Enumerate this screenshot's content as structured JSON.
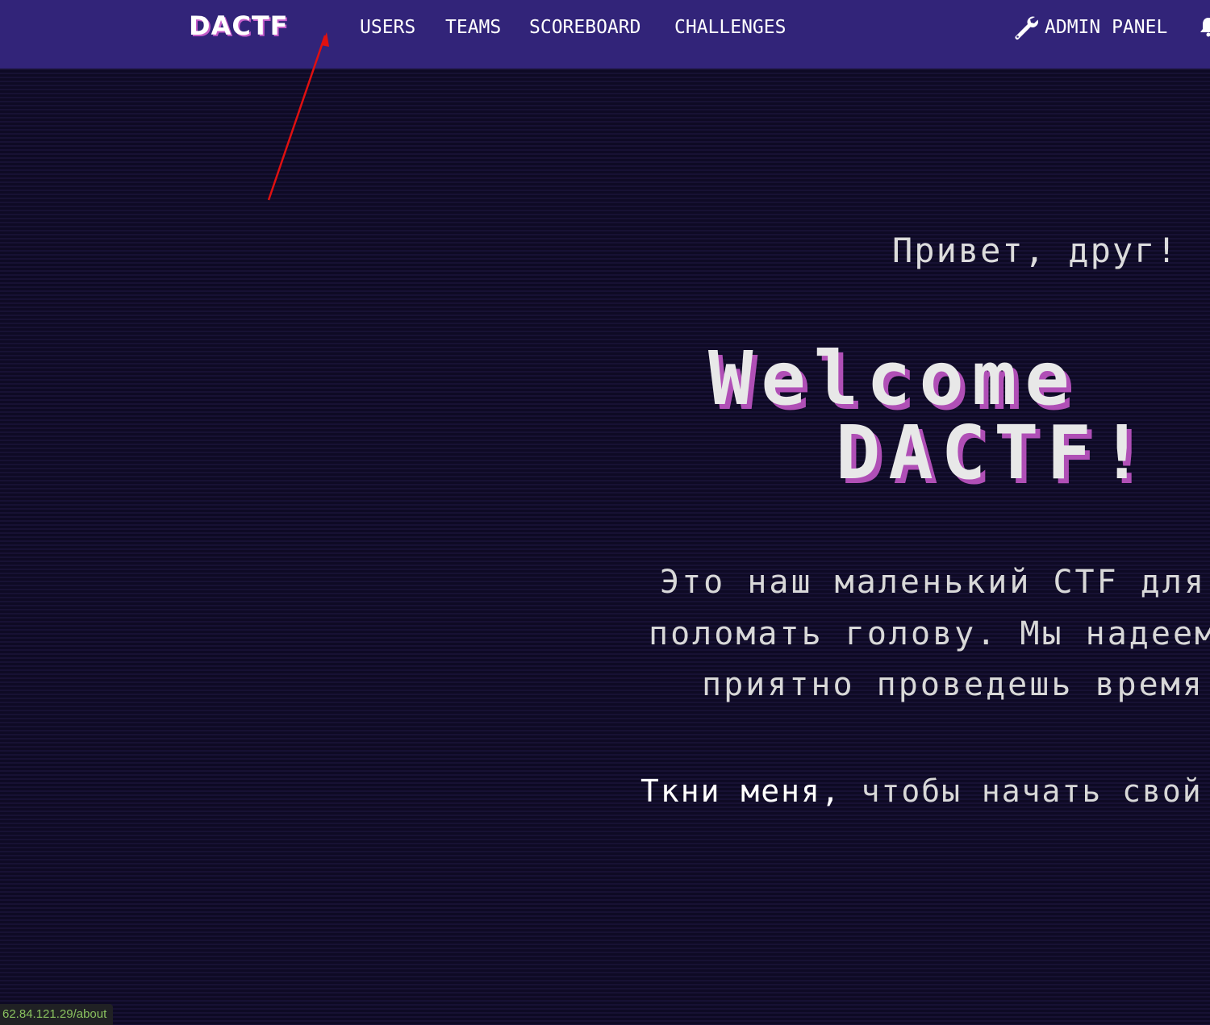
{
  "navbar": {
    "brand": "DACTF",
    "links": [
      {
        "label": "USERS"
      },
      {
        "label": "TEAMS"
      },
      {
        "label": "SCOREBOARD"
      },
      {
        "label": "CHALLENGES"
      }
    ],
    "admin_label": "ADMIN PANEL",
    "admin_icon": "wrench-icon",
    "notification_icon": "bell-icon"
  },
  "annotation": {
    "arrow_color": "#e01010"
  },
  "main": {
    "greeting": "Привет, друг!",
    "welcome_line1": "Welcome",
    "welcome_line2": "DACTF!",
    "description_lines": [
      "Это наш маленький CTF для",
      "поломать голову. Мы надеемс",
      "приятно проведешь время!"
    ],
    "cta_link": "Ткни меня,",
    "cta_rest": " чтобы начать свой пу"
  },
  "status_bar": {
    "url": "62.84.121.29/about"
  },
  "colors": {
    "navbar_bg": "#322479",
    "page_bg": "#0e0a24",
    "title_shadow": "#b04fb6",
    "status_text": "#8ac25f"
  }
}
